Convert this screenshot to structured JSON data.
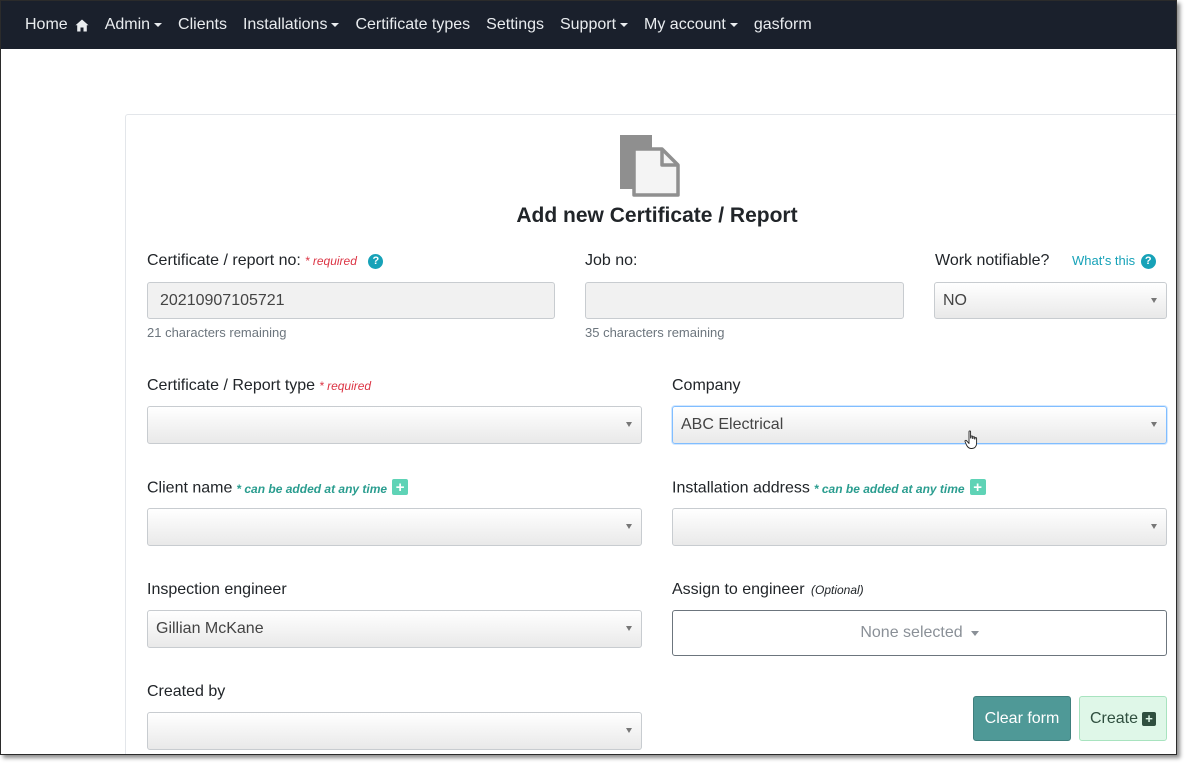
{
  "nav": {
    "home": "Home",
    "admin": "Admin",
    "clients": "Clients",
    "installations": "Installations",
    "certificate_types": "Certificate types",
    "settings": "Settings",
    "support": "Support",
    "my_account": "My account",
    "gasform": "gasform"
  },
  "page": {
    "title": "Add new Certificate / Report"
  },
  "form": {
    "cert_no": {
      "label": "Certificate / report no:",
      "required": "* required",
      "value": "20210907105721",
      "remaining": "21 characters remaining"
    },
    "job_no": {
      "label": "Job no:",
      "value": "",
      "remaining": "35 characters remaining"
    },
    "work_notifiable": {
      "label": "Work notifiable?",
      "help_link": "What's this",
      "value": "NO"
    },
    "report_type": {
      "label": "Certificate / Report type",
      "required": "* required",
      "value": ""
    },
    "company": {
      "label": "Company",
      "value": "ABC Electrical"
    },
    "client_name": {
      "label": "Client name",
      "hint": "* can be added at any time",
      "value": ""
    },
    "installation_address": {
      "label": "Installation address",
      "hint": "* can be added at any time",
      "value": ""
    },
    "inspection_engineer": {
      "label": "Inspection engineer",
      "value": "Gillian McKane"
    },
    "assign_engineer": {
      "label": "Assign to engineer",
      "optional": "(Optional)",
      "value": "None selected"
    },
    "created_by": {
      "label": "Created by",
      "value": ""
    }
  },
  "buttons": {
    "clear": "Clear form",
    "create": "Create"
  },
  "icons": {
    "help": "?",
    "plus": "+"
  },
  "colors": {
    "navbar": "#1a202c",
    "required": "#dc3545",
    "hint": "#2a9d8f",
    "clear_button": "#4f9997",
    "create_button": "#dff7e8"
  }
}
